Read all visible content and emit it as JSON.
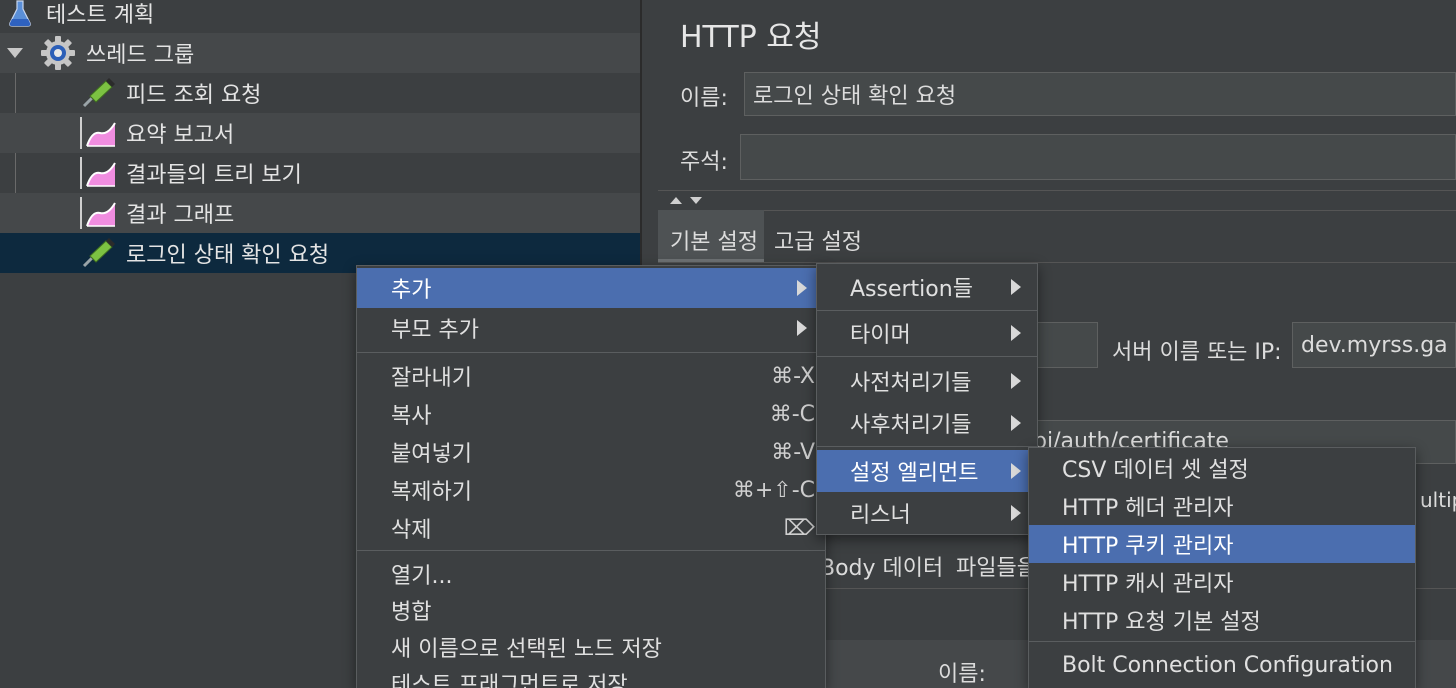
{
  "tree": {
    "items": [
      {
        "label": "테스트 계획",
        "icon": "flask-icon"
      },
      {
        "label": "쓰레드 그룹",
        "icon": "gear-icon"
      },
      {
        "label": "피드 조회 요청",
        "icon": "pipette-icon"
      },
      {
        "label": "요약 보고서",
        "icon": "chart-icon"
      },
      {
        "label": "결과들의 트리 보기",
        "icon": "chart-icon"
      },
      {
        "label": "결과 그래프",
        "icon": "chart-icon"
      },
      {
        "label": "로그인 상태 확인 요청",
        "icon": "pipette-icon"
      }
    ]
  },
  "panel": {
    "title": "HTTP 요청",
    "name_label": "이름:",
    "name_value": "로그인 상태 확인 요청",
    "comment_label": "주석:",
    "comment_value": "",
    "tabs": [
      "기본 설정",
      "고급 설정"
    ],
    "server_label": "서버 이름 또는 IP:",
    "server_value": "dev.myrss.ga",
    "path_partial": "pi/auth/certificate",
    "multipart_partial": "ultip",
    "body_tabs": [
      "Body 데이터",
      "파일들을"
    ],
    "bottom_name_label": "이름:"
  },
  "context_menu": {
    "items": [
      {
        "label": "추가",
        "submenu": true,
        "highlighted": true
      },
      {
        "label": "부모 추가",
        "submenu": true
      },
      {
        "separator": true
      },
      {
        "label": "잘라내기",
        "shortcut": "⌘-X"
      },
      {
        "label": "복사",
        "shortcut": "⌘-C"
      },
      {
        "label": "붙여넣기",
        "shortcut": "⌘-V"
      },
      {
        "label": "복제하기",
        "shortcut": "⌘+⇧-C"
      },
      {
        "label": "삭제",
        "shortcut": "⌦"
      },
      {
        "separator": true
      },
      {
        "label": "열기..."
      },
      {
        "label": "병합"
      },
      {
        "label": "새 이름으로 선택된 노드 저장"
      },
      {
        "label": "테스트 프래그먼트로 저장"
      }
    ]
  },
  "add_menu": {
    "items": [
      "Assertion들",
      "타이머",
      "사전처리기들",
      "사후처리기들",
      "설정 엘리먼트",
      "리스너"
    ],
    "highlighted_index": 4
  },
  "config_menu": {
    "items": [
      "CSV 데이터 셋 설정",
      "HTTP 헤더 관리자",
      "HTTP 쿠키 관리자",
      "HTTP 캐시 관리자",
      "HTTP 요청 기본 설정",
      "Bolt Connection Configuration"
    ],
    "highlighted_index": 2
  },
  "colors": {
    "background": "#3c3f41",
    "selection": "#0d293e",
    "menu_highlight": "#4b6eaf"
  }
}
